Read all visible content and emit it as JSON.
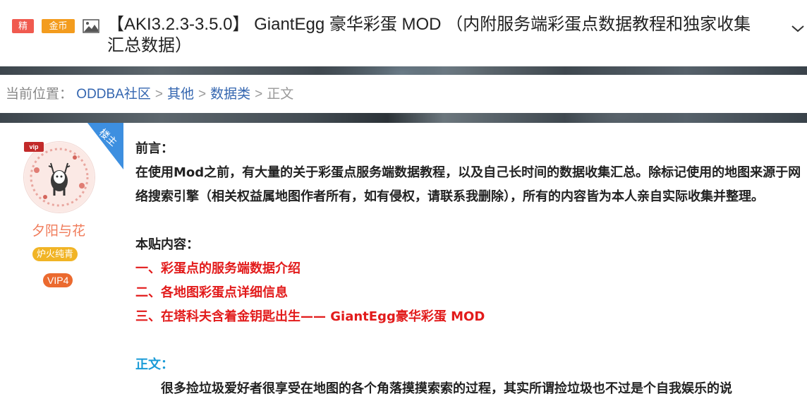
{
  "header": {
    "tag_jing": "精",
    "tag_coin": "金币",
    "image_icon": "image-icon",
    "title": "【AKI3.2.3-3.5.0】 GiantEgg 豪华彩蛋 MOD （内附服务端彩蛋点数据教程和独家收集汇总数据）",
    "expand_icon": "chevron-down-icon"
  },
  "breadcrumb": {
    "prefix": "当前位置：",
    "items": [
      "ODDBA社区",
      "其他",
      "数据类"
    ],
    "separator": ">",
    "current": "正文"
  },
  "author": {
    "floor_badge": "楼主",
    "vip_mark": "vip",
    "name": "夕阳与花",
    "group": "炉火纯青",
    "vip_level": "VIP4"
  },
  "post": {
    "preface_title": "前言：",
    "preface_body": "在使用Mod之前，有大量的关于彩蛋点服务端数据教程，以及自己长时间的数据收集汇总。除标记使用的地图来源于网络搜索引擎（相关权益属地图作者所有，如有侵权，请联系我删除），所有的内容皆为本人亲自实际收集并整理。",
    "contents_title": "本贴内容：",
    "contents_items": [
      "一、彩蛋点的服务端数据介绍",
      "二、各地图彩蛋点详细信息",
      "三、在塔科夫含着金钥匙出生—— GiantEgg豪华彩蛋 MOD"
    ],
    "main_title": "正文：",
    "main_body": "很多捡垃圾爱好者很享受在地图的各个角落摸摸索索的过程，其实所谓捡垃圾也不过是个自我娱乐的说"
  },
  "colors": {
    "jing": "#f05a4f",
    "coin": "#f39c1e",
    "link": "#3466b0",
    "red_heading": "#e21b1b",
    "cyan_heading": "#1a9bd7",
    "author_name": "#f07b5a",
    "floor_badge": "#3d8fe0"
  }
}
